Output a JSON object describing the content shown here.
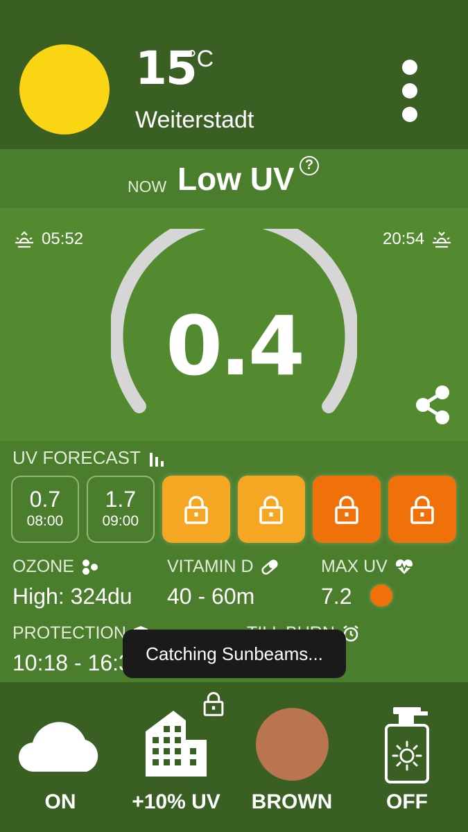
{
  "header": {
    "temperature": "15",
    "temperature_unit": "°C",
    "location": "Weiterstadt",
    "weather_icon": "sun-icon",
    "menu_icon": "more-vert-icon"
  },
  "now": {
    "label": "NOW",
    "level": "Low UV",
    "help_icon": "help-icon"
  },
  "gauge": {
    "sunrise": "05:52",
    "sunset": "20:54",
    "uv_index": "0.4",
    "uv_fraction": 0.04,
    "share_icon": "share-icon"
  },
  "forecast": {
    "title": "UV FORECAST",
    "items": [
      {
        "value": "0.7",
        "time": "08:00",
        "locked": false
      },
      {
        "value": "1.7",
        "time": "09:00",
        "locked": false
      },
      {
        "locked": true,
        "color": "#f5a623"
      },
      {
        "locked": true,
        "color": "#f5a623"
      },
      {
        "locked": true,
        "color": "#f07009"
      },
      {
        "locked": true,
        "color": "#f07009"
      }
    ]
  },
  "stats": {
    "ozone": {
      "label": "OZONE",
      "value": "High: 324du"
    },
    "vitamin_d": {
      "label": "VITAMIN D",
      "value": "40 - 60m"
    },
    "max_uv": {
      "label": "MAX UV",
      "value": "7.2"
    },
    "protection": {
      "label": "PROTECTION",
      "value": "10:18 - 16:33"
    },
    "till_burn": {
      "label": "TILL BURN",
      "value": "∞"
    }
  },
  "toast": "Catching Sunbeams...",
  "bottom": {
    "cloud": {
      "label": "ON"
    },
    "city": {
      "label": "+10% UV"
    },
    "skin": {
      "label": "BROWN",
      "color": "#b97450"
    },
    "sunscreen": {
      "label": "OFF"
    }
  },
  "colors": {
    "dark_green": "#3a5f23",
    "mid_green": "#4a7e2c",
    "light_green": "#548a2f",
    "sun_yellow": "#fad514",
    "uv_orange": "#f07009",
    "uv_amber": "#f5a623"
  }
}
